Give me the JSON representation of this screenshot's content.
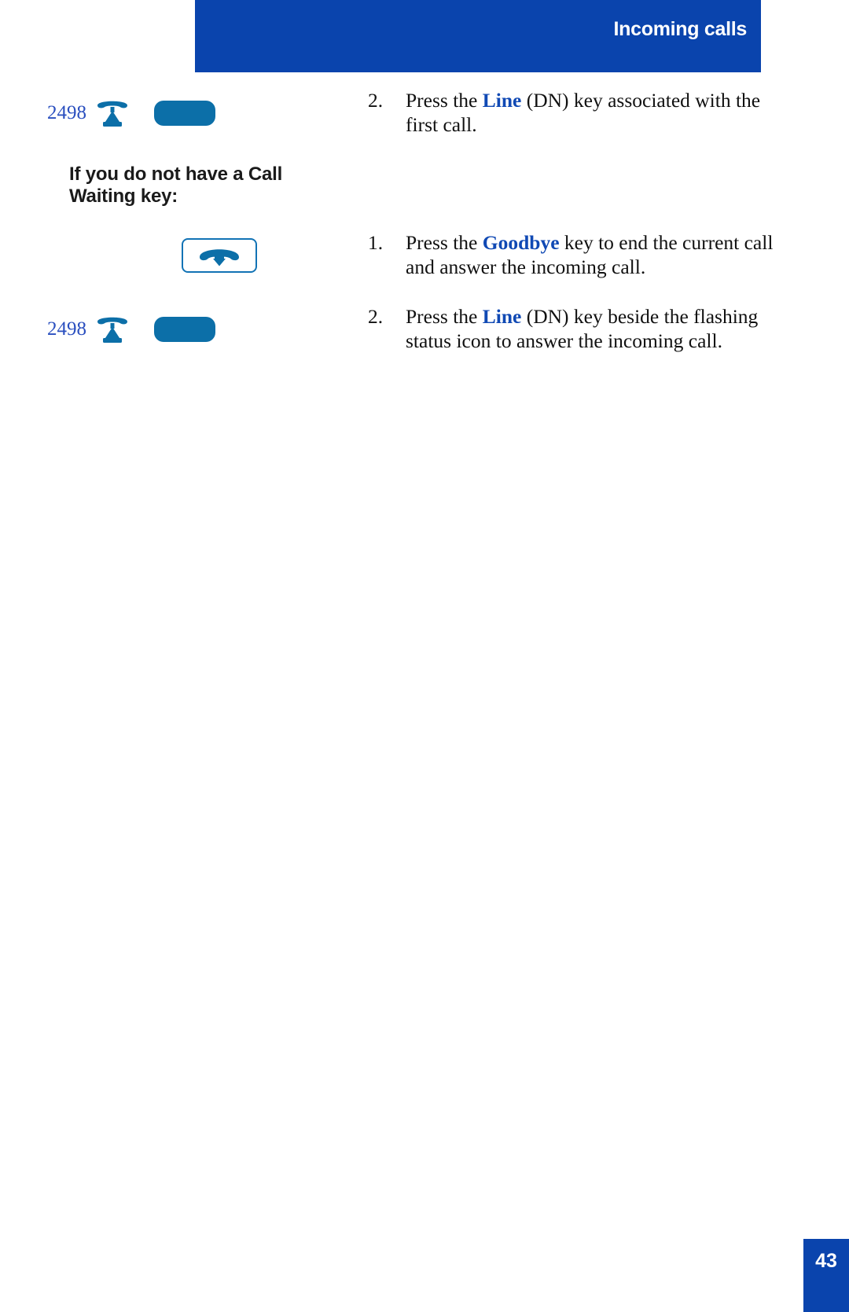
{
  "header": {
    "title": "Incoming calls",
    "bar_color": "#0A44AD"
  },
  "colors": {
    "header_blue": "#0A44AD",
    "keyword_blue": "#1049B4",
    "dn_blue": "#2A4FBF",
    "icon_blue": "#0C6FA8",
    "key_outline_blue": "#1273B5"
  },
  "figures": {
    "dn_label_top": "2498",
    "dn_label_bottom": "2498",
    "phone_icon_name": "desk-phone-icon",
    "line_key_name": "line-dn-key",
    "goodbye_key_name": "goodbye-key"
  },
  "section_heading": "If you do not have a Call Waiting key:",
  "steps": {
    "top": {
      "number": "2.",
      "before": "Press the ",
      "keyword": "Line",
      "after": " (DN) key associated with the first call."
    },
    "second_1": {
      "number": "1.",
      "before": "Press the ",
      "keyword": "Goodbye",
      "after": " key to end the current call and answer the incoming call."
    },
    "second_2": {
      "number": "2.",
      "before": "Press the ",
      "keyword": "Line",
      "after": " (DN) key beside the flashing status icon to answer the incoming call."
    }
  },
  "footer": {
    "page_number": "43"
  }
}
